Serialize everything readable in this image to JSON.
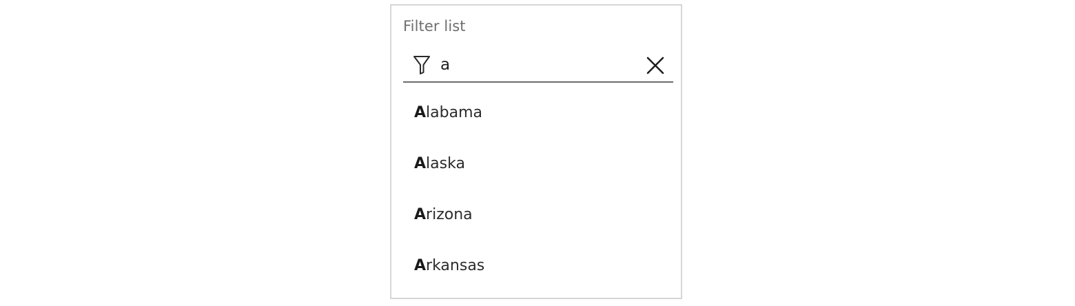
{
  "filter": {
    "label": "Filter list",
    "query": "a",
    "icon": "filter-icon",
    "clear_icon": "close-icon"
  },
  "results": [
    {
      "match": "A",
      "rest": "labama"
    },
    {
      "match": "A",
      "rest": "laska"
    },
    {
      "match": "A",
      "rest": "rizona"
    },
    {
      "match": "A",
      "rest": "rkansas"
    }
  ],
  "colors": {
    "border": "#d6d6d6",
    "underline": "#6b6b6b",
    "label": "#6e6e6e",
    "text": "#2b2b2b"
  }
}
